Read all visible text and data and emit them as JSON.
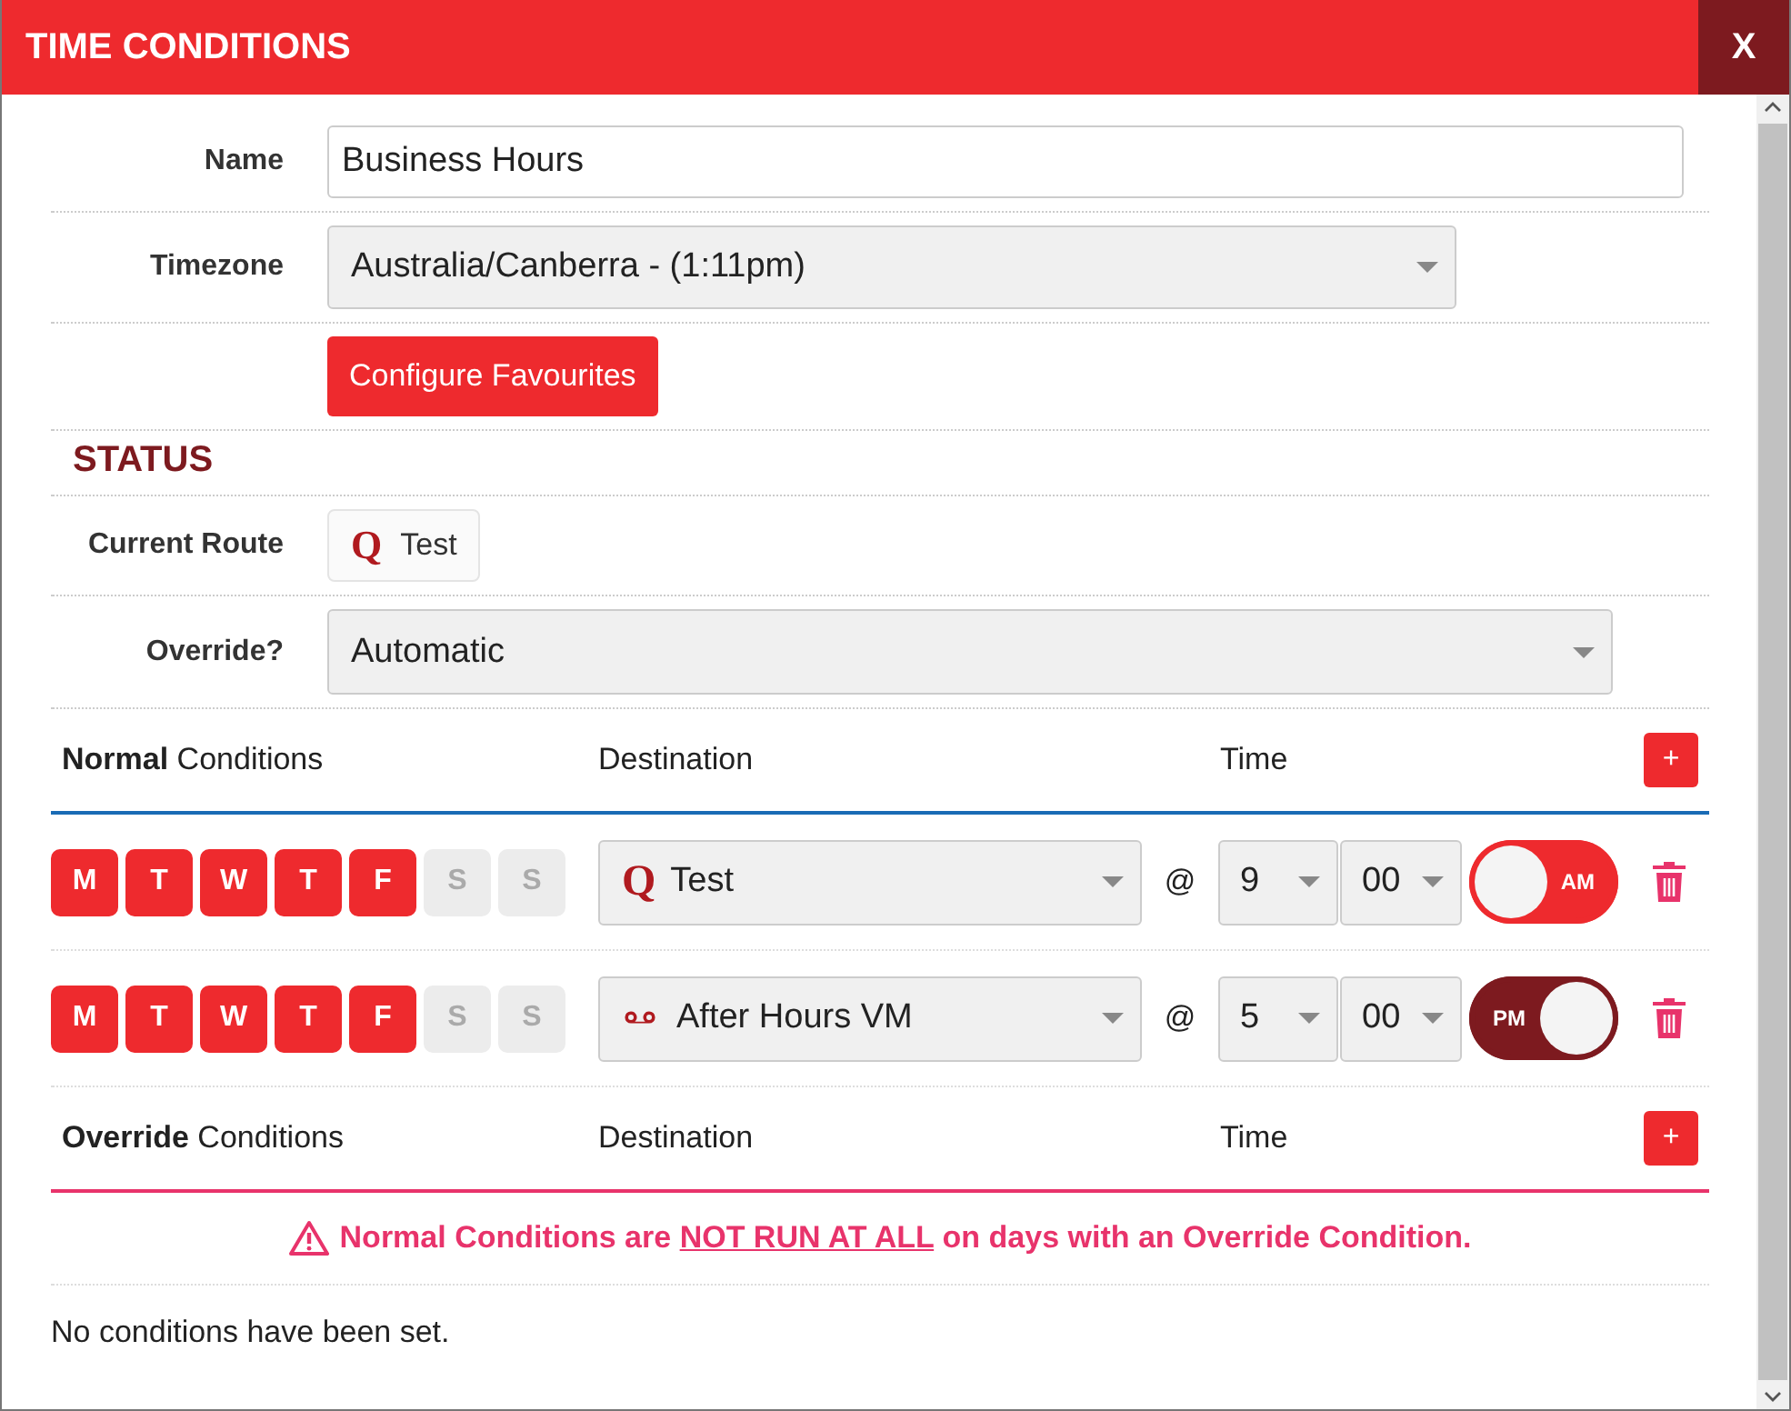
{
  "window": {
    "title": "TIME CONDITIONS",
    "close": "X"
  },
  "form": {
    "name": {
      "label": "Name",
      "value": "Business Hours"
    },
    "timezone": {
      "label": "Timezone",
      "value": "Australia/Canberra - (1:11pm)"
    },
    "favourites_button": "Configure Favourites"
  },
  "status": {
    "heading": "STATUS",
    "current_route": {
      "label": "Current Route",
      "icon": "Q",
      "value": "Test"
    },
    "override": {
      "label": "Override?",
      "value": "Automatic"
    }
  },
  "normal": {
    "columns": [
      "**Normal** Conditions",
      "Destination",
      "Time"
    ],
    "add": "+",
    "rows": [
      {
        "days": [
          {
            "label": "M",
            "selected": true
          },
          {
            "label": "T",
            "selected": true
          },
          {
            "label": "W",
            "selected": true
          },
          {
            "label": "T",
            "selected": true
          },
          {
            "label": "F",
            "selected": true
          },
          {
            "label": "S",
            "selected": false
          },
          {
            "label": "S",
            "selected": false
          }
        ],
        "destination": {
          "kind": "queue",
          "icon": "Q",
          "value": "Test"
        },
        "at": "@",
        "hour": "9",
        "minute": "00",
        "meridiem": "AM",
        "pm": false
      },
      {
        "days": [
          {
            "label": "M",
            "selected": true
          },
          {
            "label": "T",
            "selected": true
          },
          {
            "label": "W",
            "selected": true
          },
          {
            "label": "T",
            "selected": true
          },
          {
            "label": "F",
            "selected": true
          },
          {
            "label": "S",
            "selected": false
          },
          {
            "label": "S",
            "selected": false
          }
        ],
        "destination": {
          "kind": "voicemail",
          "value": "After Hours VM"
        },
        "at": "@",
        "hour": "5",
        "minute": "00",
        "meridiem": "PM",
        "pm": true
      }
    ]
  },
  "override": {
    "columns": [
      "**Override** Conditions",
      "Destination",
      "Time"
    ],
    "add": "+",
    "warning": {
      "before": "Normal Conditions are",
      "emphasis": "NOT RUN AT ALL",
      "after": "on days with an Override Condition."
    },
    "empty": "No conditions have been set."
  }
}
